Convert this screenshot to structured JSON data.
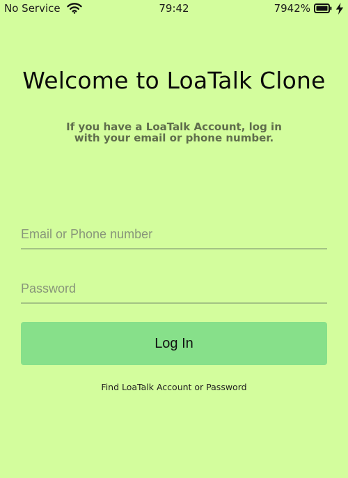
{
  "colors": {
    "background": "#d3fd9d",
    "button": "#87e08a",
    "field_underline": "#a3c384",
    "subtitle": "#5f6e4c"
  },
  "status_bar": {
    "carrier": "No Service",
    "time": "79:42",
    "battery_percent": "7942%",
    "icons": [
      "wifi-icon",
      "battery-icon",
      "charging-bolt-icon"
    ]
  },
  "welcome": {
    "title": "Welcome to LoaTalk Clone",
    "subtitle": "If you have a LoaTalk Account, log in with your email or phone number."
  },
  "form": {
    "email_placeholder": "Email or Phone number",
    "email_value": "",
    "password_placeholder": "Password",
    "password_value": "",
    "login_label": "Log In"
  },
  "links": {
    "find_account": "Find LoaTalk Account or Password"
  }
}
